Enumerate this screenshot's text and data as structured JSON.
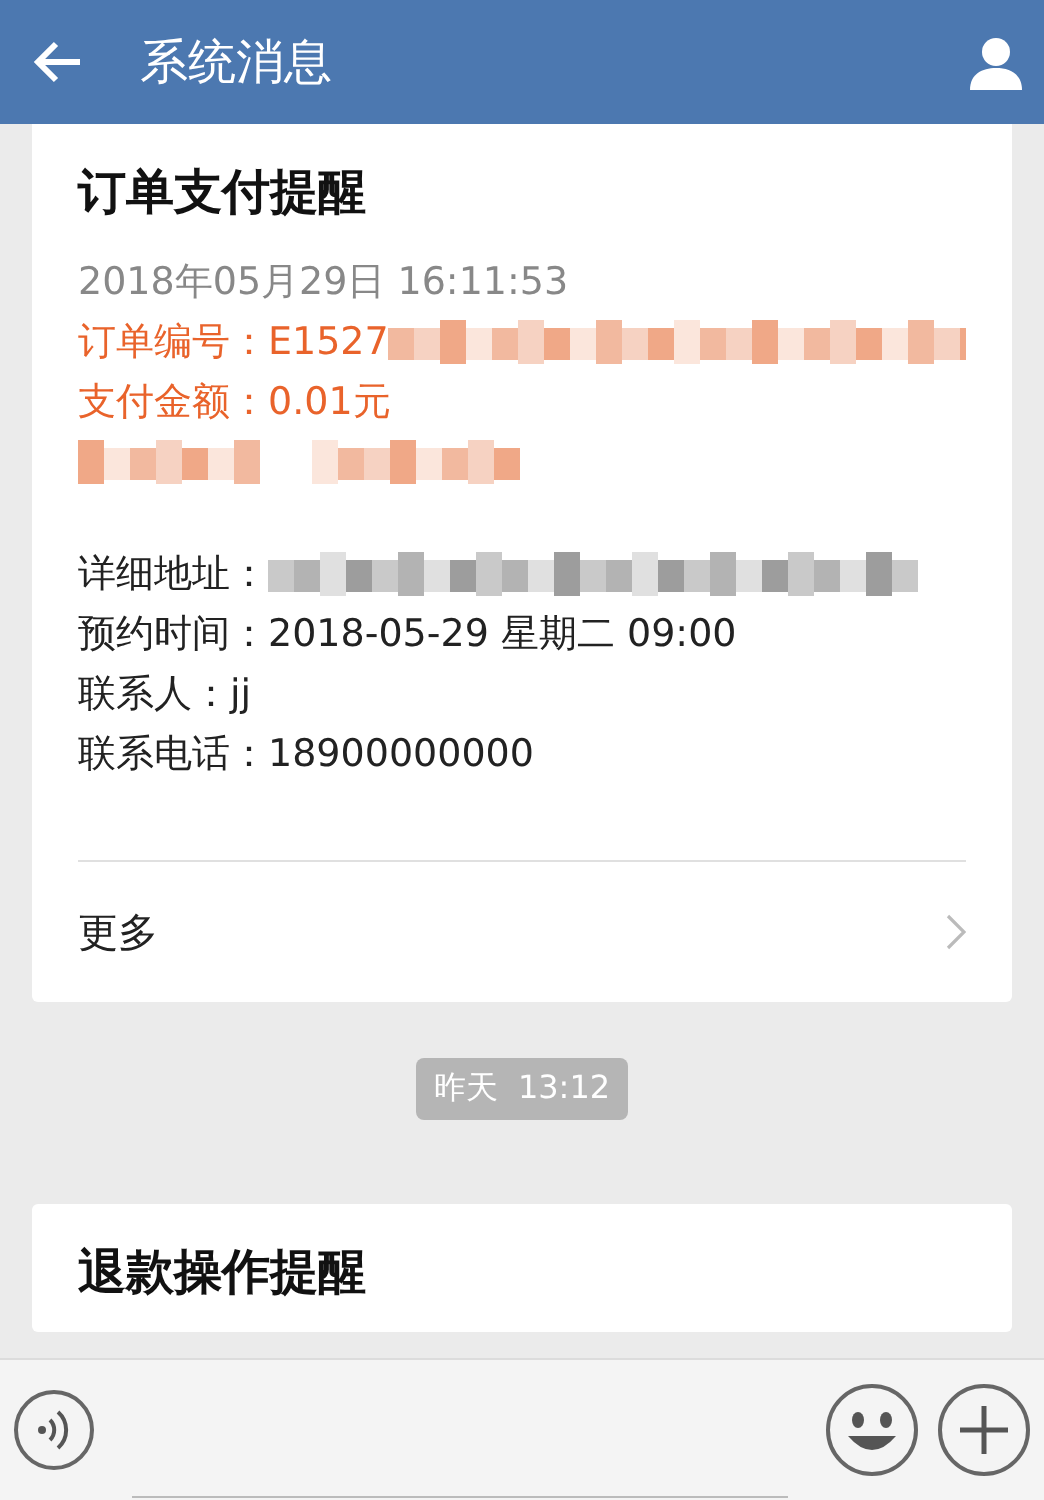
{
  "header": {
    "title": "系统消息"
  },
  "messages": [
    {
      "title": "订单支付提醒",
      "groups": [
        [
          {
            "kind": "meta",
            "text": "2018年05月29日 16:11:53",
            "redacted": false
          },
          {
            "kind": "accent",
            "text": "订单编号：E1527",
            "redacted": true
          },
          {
            "kind": "accent",
            "text": "支付金额：0.01元",
            "redacted": false
          },
          {
            "kind": "accent",
            "redacted": true
          }
        ],
        [
          {
            "kind": "plain",
            "text": "详细地址：",
            "redacted": true
          },
          {
            "kind": "plain",
            "text": "预约时间：2018-05-29 星期二 09:00",
            "redacted": false
          },
          {
            "kind": "plain",
            "text": "联系人：jj",
            "redacted": false
          },
          {
            "kind": "plain",
            "text": "联系电话：18900000000",
            "redacted": false
          }
        ]
      ],
      "more": "更多"
    },
    {
      "title": "退款操作提醒"
    }
  ],
  "timestamp": {
    "day": "昨天",
    "time": "13:12"
  }
}
